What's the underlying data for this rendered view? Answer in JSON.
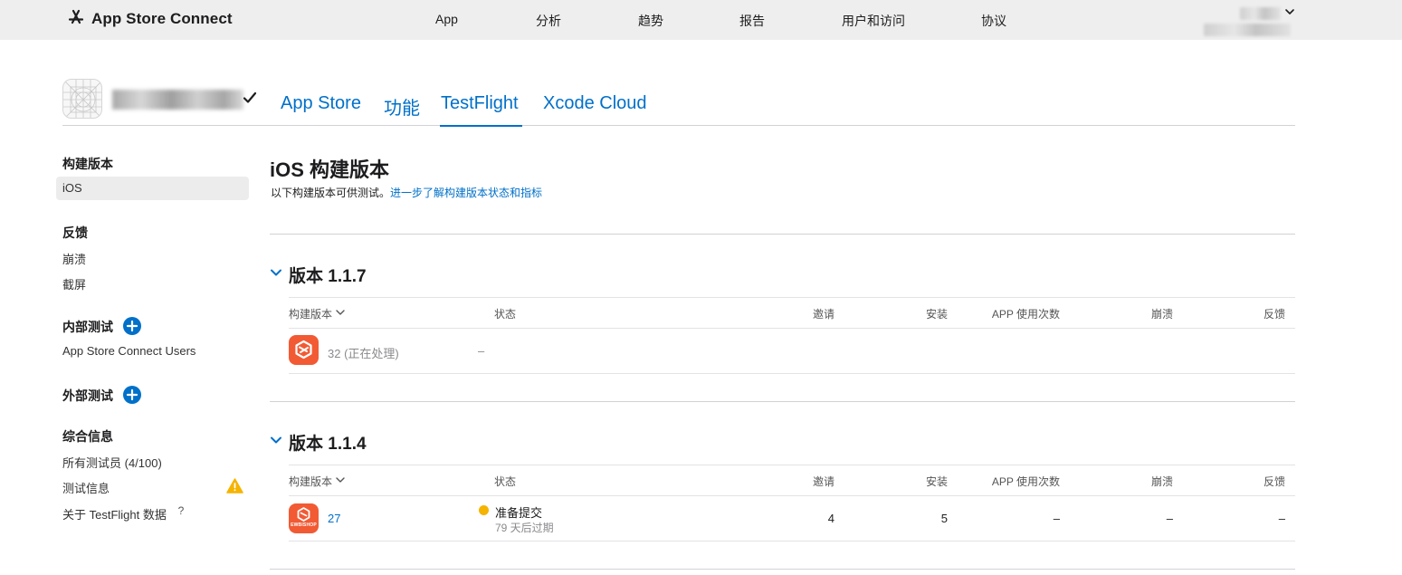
{
  "topbar": {
    "brand": "App Store Connect",
    "nav": [
      "App",
      "分析",
      "趋势",
      "报告",
      "用户和访问",
      "协议"
    ]
  },
  "app": {
    "tabs": [
      "App Store",
      "功能",
      "TestFlight",
      "Xcode Cloud"
    ],
    "active_tab": "TestFlight"
  },
  "sidebar": {
    "builds_heading": "构建版本",
    "builds_ios": "iOS",
    "feedback_heading": "反馈",
    "feedback_crashes": "崩溃",
    "feedback_screenshots": "截屏",
    "internal_heading": "内部测试",
    "internal_group": "App Store Connect Users",
    "external_heading": "外部测试",
    "general_heading": "综合信息",
    "general_testers": "所有测试员 (4/100)",
    "general_test_info": "测试信息",
    "general_about": "关于 TestFlight 数据",
    "help_glyph": "?"
  },
  "main": {
    "title": "iOS 构建版本",
    "subtitle": "以下构建版本可供测试。",
    "subtitle_link": "进一步了解构建版本状态和指标"
  },
  "table_headers": {
    "build": "构建版本",
    "status": "状态",
    "invites": "邀请",
    "installs": "安装",
    "sessions": "APP 使用次数",
    "crashes": "崩溃",
    "feedback": "反馈"
  },
  "versions": [
    {
      "title": "版本 1.1.7",
      "build": "32 (正在处理)",
      "status": "–"
    },
    {
      "title": "版本 1.1.4",
      "build": "27",
      "status": "准备提交",
      "status_sub": "79 天后过期",
      "invites": "4",
      "installs": "5",
      "sessions": "–",
      "crashes": "–",
      "feedback": "–",
      "icon_text": "EWBISHOP"
    }
  ],
  "colors": {
    "link": "#0070c9",
    "icon_bg": "#f25a34",
    "warning": "#f5b400",
    "topbar_bg": "#eeeeee"
  }
}
